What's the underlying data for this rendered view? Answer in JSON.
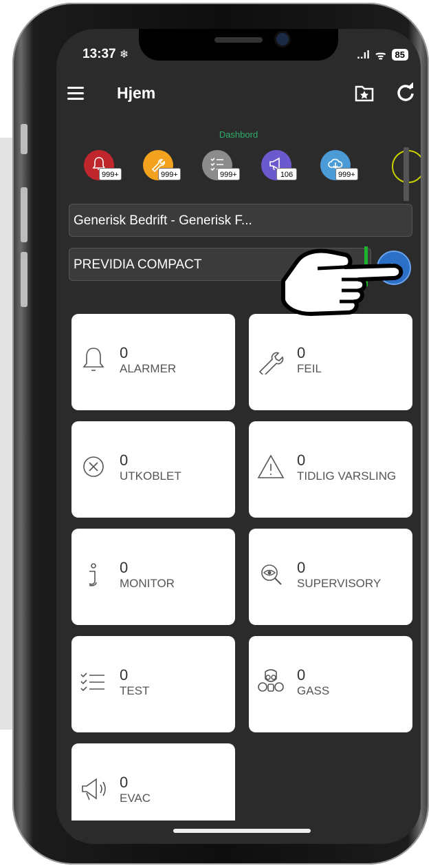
{
  "status": {
    "time": "13:37",
    "snow": "❄",
    "signal": "..ıl",
    "wifi": "ᯤ",
    "battery": "85"
  },
  "header": {
    "title": "Hjem"
  },
  "dashboard": {
    "label": "Dashbord",
    "tiles": [
      {
        "name": "alarm-tile",
        "badge": "999+",
        "color": "#c0272d",
        "icon": "bell-icon"
      },
      {
        "name": "fault-tile",
        "badge": "999+",
        "color": "#f2a21f",
        "icon": "wrench-icon"
      },
      {
        "name": "test-tile",
        "badge": "999+",
        "color": "#8c8c8c",
        "icon": "checklist-icon"
      },
      {
        "name": "evac-tile",
        "badge": "106",
        "color": "#6a5acd",
        "icon": "megaphone-icon"
      },
      {
        "name": "cloud-tile",
        "badge": "999+",
        "color": "#4a9bd6",
        "icon": "cloud-icon"
      }
    ]
  },
  "site_selector": {
    "value": "Generisk Bedrift - Generisk F..."
  },
  "panel_selector": {
    "value": "PREVIDIA COMPACT"
  },
  "cards": [
    {
      "count": "0",
      "label": "ALARMER",
      "icon": "bell-icon"
    },
    {
      "count": "0",
      "label": "FEIL",
      "icon": "wrench-icon"
    },
    {
      "count": "0",
      "label": "UTKOBLET",
      "icon": "disabled-x-icon"
    },
    {
      "count": "0",
      "label": "TIDLIG VARSLING",
      "icon": "warning-triangle-icon"
    },
    {
      "count": "0",
      "label": "MONITOR",
      "icon": "info-icon"
    },
    {
      "count": "0",
      "label": "SUPERVISORY",
      "icon": "eye-magnifier-icon"
    },
    {
      "count": "0",
      "label": "TEST",
      "icon": "checklist-icon"
    },
    {
      "count": "0",
      "label": "GASS",
      "icon": "gas-mask-icon"
    },
    {
      "count": "0",
      "label": "EVAC",
      "icon": "megaphone-icon"
    }
  ],
  "colors": {
    "accent": "#2c6fc6",
    "dashboard_label": "#2db06a",
    "status_bar_green": "#1bb42a"
  }
}
